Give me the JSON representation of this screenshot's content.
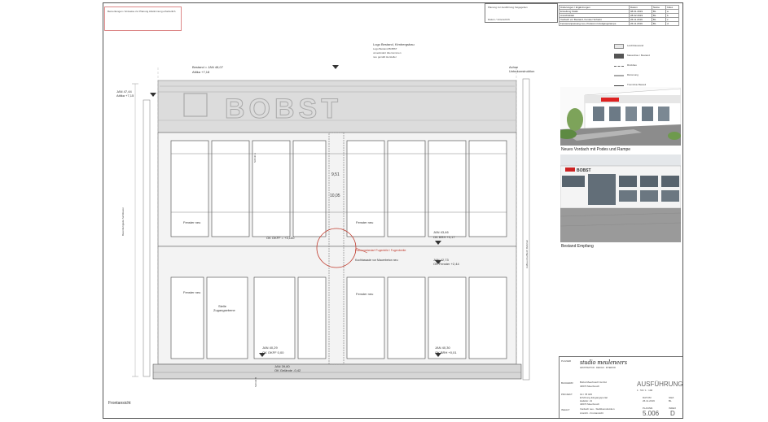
{
  "notes": {
    "red_note": "Bemerkungen / Hinweise zur Planung Abstimmung erforderlich",
    "planning_box": "Planung zur Ausführung freigegeben",
    "planning_sub": "Datum / Unterschrift",
    "logo_note_title": "Logo Bestand, Kirnbergsbau",
    "logo_note_line1": "Logo Bestand BOBST",
    "logo_note_line2": "unverändert übernommen",
    "logo_note_line3": "neu gemäß Hersteller"
  },
  "revisions": {
    "headers": [
      "Änderungen / Ergänzungen",
      "Datum",
      "Name",
      "Index"
    ],
    "rows": [
      [
        "Erstellung Statik",
        "08.01.2019",
        "BL",
        "a"
      ],
      [
        "Ansichtsblatt",
        "28.02.2019",
        "BL",
        "b"
      ],
      [
        "Vordach vor Bestand, Fenster Schiebt",
        "26.11.2019",
        "BL",
        "c"
      ],
      [
        "Fensteranpassung neu, Podest mit Aufgangsrampe",
        "26.11.2019",
        "BL",
        "d"
      ]
    ]
  },
  "legend": {
    "items": [
      "Leichtbauwand",
      "Massivbau / Bestand",
      "Rückbau",
      "Dämmung",
      "Trennlinie Bauteil"
    ]
  },
  "photos": {
    "caption1": "Neues Vordach mit Podes und Rampe",
    "caption2": "Bestand Empfang",
    "sign_text": "BOBST"
  },
  "drawing": {
    "logo_text": "BOBST",
    "label_front": "Frontansicht",
    "bestand": "Bestand = JAN 48,07",
    "attika": "Attika +7,18",
    "level_a": "JAN 47,44",
    "level_a2": "Attika +7,15",
    "dim_951": "9,51",
    "dim_1005": "10,05",
    "ok_dhrw": "OK OKFF = +3,150",
    "fenster_neu_1": "Fenster neu",
    "fenster_neu_2": "Fenster neu",
    "fenster_neu_3": "Fenster neu",
    "fenster_neu_4": "Fenster neu",
    "red_circle_label": "Planungsbedarf Fugenbild / Fugenbreite",
    "detail_note": "Kochfassade vor Mauerbeton neu",
    "jan_4346": "JAN 43,46",
    "ok_brh_317": "OK BRH +3,17",
    "jan_4273": "JAN 42,73",
    "ok_fenster_244": "OK Fenster +2,44",
    "stelle": "Stelle",
    "zugangsebene": "Zugangsebene",
    "jan_4029": "JAN 40,29",
    "ok_okff_000": "OK OKFF 0,00",
    "jan_4030": "JAN 40,30",
    "ok_brh_001": "OK BRH +0,01",
    "jan_3980": "JAN 39,80",
    "ok_gelaende": "OK Gelände -0,42",
    "vertical_left": "Betonfertigteile Sichtbeton",
    "vertical_right": "Aufbau Alu-Blech Rahmen",
    "achse": "Achse Unterkonstruktion",
    "schnitt_a": "Schnitt A",
    "schnitt_b": "Schnitt B"
  },
  "titleblock": {
    "planer_label": "PLANER",
    "studio_name": "studio meuleneers",
    "studio_sub": "ARCHITEKTUR · DESIGN · INTERIOR",
    "bauherr_label": "BAUHERR",
    "bauherr_name": "Bobst Meerbusch GmbH",
    "bauherr_ort": "40670 Meerbusch",
    "status": "AUSFÜHRUNG",
    "scale_label": "1 : 50 / 1 : 100",
    "projekt_label": "PROJEKT",
    "projekt_nr": "19 / 78 025",
    "projekt_name": "Erhöhung Eingangsportal",
    "projekt_strasse": "Hafelstr. 21",
    "projekt_ort": "40670 Meerbusch",
    "datum_label": "DATUM",
    "datum": "26.11.2019",
    "bl_label": "GEZ.",
    "bl": "BL",
    "inhalt_label": "INHALT",
    "inhalt_1": "Vordach neu - Stahlkonstruktion",
    "inhalt_2": "Ansicht - Frontansicht",
    "plannr_label": "PLANNR.",
    "plannr": "5.006",
    "index_label": "INDEX",
    "index": "D"
  }
}
